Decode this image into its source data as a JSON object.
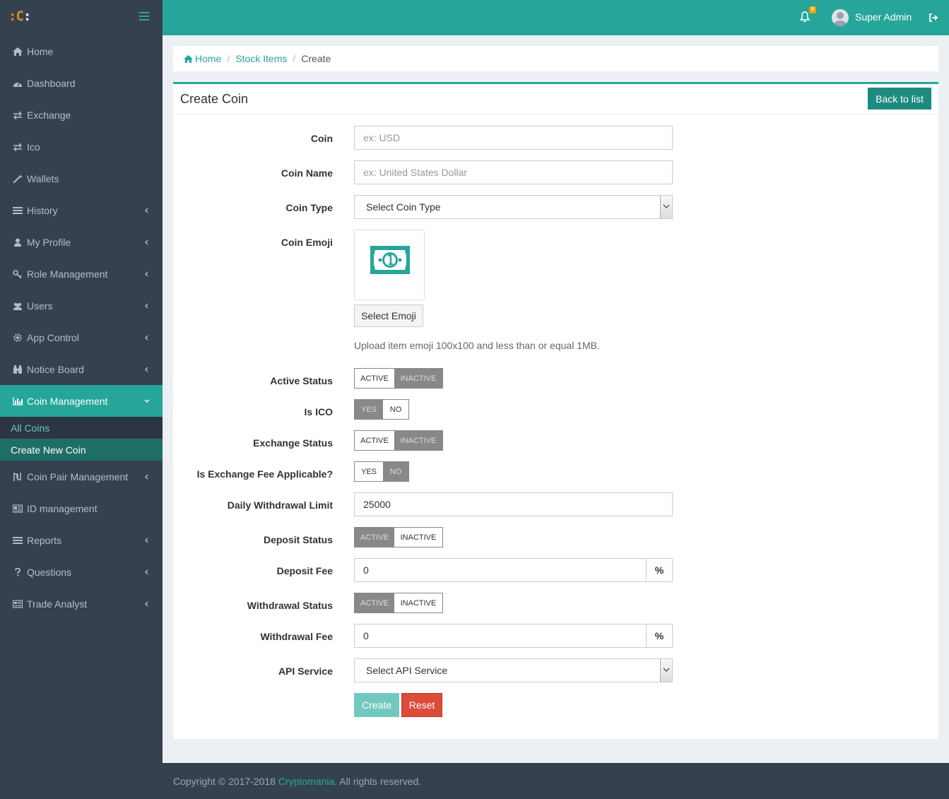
{
  "brand": {
    "logo_prefix": ":C",
    "logo_suffix": ":"
  },
  "sidebar": {
    "items": [
      {
        "label": "Home",
        "icon": "home-icon",
        "chevron": false
      },
      {
        "label": "Dashboard",
        "icon": "dashboard-icon",
        "chevron": false
      },
      {
        "label": "Exchange",
        "icon": "exchange-icon",
        "chevron": false
      },
      {
        "label": "Ico",
        "icon": "exchange-icon",
        "chevron": false
      },
      {
        "label": "Wallets",
        "icon": "magic-wand-icon",
        "chevron": false
      },
      {
        "label": "History",
        "icon": "list-icon",
        "chevron": true
      },
      {
        "label": "My Profile",
        "icon": "user-icon",
        "chevron": true
      },
      {
        "label": "Role Management",
        "icon": "key-icon",
        "chevron": true
      },
      {
        "label": "Users",
        "icon": "users-icon",
        "chevron": true
      },
      {
        "label": "App Control",
        "icon": "gear-icon",
        "chevron": true
      },
      {
        "label": "Notice Board",
        "icon": "binoculars-icon",
        "chevron": true
      },
      {
        "label": "Coin Management",
        "icon": "bar-chart-icon",
        "chevron": true
      },
      {
        "label": "Coin Pair Management",
        "icon": "coin-pair-icon",
        "chevron": true
      },
      {
        "label": "ID management",
        "icon": "id-card-icon",
        "chevron": false
      },
      {
        "label": "Reports",
        "icon": "list-icon",
        "chevron": true
      },
      {
        "label": "Questions",
        "icon": "question-icon",
        "chevron": true
      },
      {
        "label": "Trade Analyst",
        "icon": "newspaper-icon",
        "chevron": true
      }
    ],
    "active_item": "Coin Management",
    "sub_items": [
      "All Coins",
      "Create New Coin"
    ],
    "current_sub": "Create New Coin"
  },
  "header": {
    "notification_count": "0",
    "username": "Super Admin"
  },
  "breadcrumb": {
    "home": "Home",
    "section": "Stock Items",
    "current": "Create",
    "separator": "/"
  },
  "panel": {
    "title": "Create Coin",
    "back_button": "Back to list"
  },
  "form": {
    "coin": {
      "label": "Coin",
      "placeholder": "ex: USD"
    },
    "coin_name": {
      "label": "Coin Name",
      "placeholder": "ex: United States Dollar"
    },
    "coin_type": {
      "label": "Coin Type",
      "value": "Select Coin Type"
    },
    "coin_emoji": {
      "label": "Coin Emoji",
      "button": "Select Emoji",
      "hint": "Upload item emoji 100x100 and less than or equal 1MB.",
      "icon": "money-bill-icon"
    },
    "active_status": {
      "label": "Active Status",
      "options": [
        "ACTIVE",
        "INACTIVE"
      ],
      "selected": "ACTIVE"
    },
    "is_ico": {
      "label": "Is ICO",
      "options": [
        "YES",
        "NO"
      ],
      "selected": "NO"
    },
    "exchange_status": {
      "label": "Exchange Status",
      "options": [
        "ACTIVE",
        "INACTIVE"
      ],
      "selected": "ACTIVE"
    },
    "exchange_fee": {
      "label": "Is Exchange Fee Applicable?",
      "options": [
        "YES",
        "NO"
      ],
      "selected": "YES"
    },
    "daily_withdrawal_limit": {
      "label": "Daily Withdrawal Limit",
      "value": "25000"
    },
    "deposit_status": {
      "label": "Deposit Status",
      "options": [
        "ACTIVE",
        "INACTIVE"
      ],
      "selected": "INACTIVE"
    },
    "deposit_fee": {
      "label": "Deposit Fee",
      "value": "0",
      "unit": "%"
    },
    "withdrawal_status": {
      "label": "Withdrawal Status",
      "options": [
        "ACTIVE",
        "INACTIVE"
      ],
      "selected": "INACTIVE"
    },
    "withdrawal_fee": {
      "label": "Withdrawal Fee",
      "value": "0",
      "unit": "%"
    },
    "api_service": {
      "label": "API Service",
      "value": "Select API Service"
    },
    "create_button": "Create",
    "reset_button": "Reset"
  },
  "footer": {
    "prefix": "Copyright © 2017-2018 ",
    "brand": "Cryptomania",
    "suffix": ". All rights reserved."
  },
  "colors": {
    "accent": "#26a69a",
    "sidebar_bg": "#364150",
    "danger": "#dd4b39",
    "content_bg": "#ecf0f5"
  }
}
